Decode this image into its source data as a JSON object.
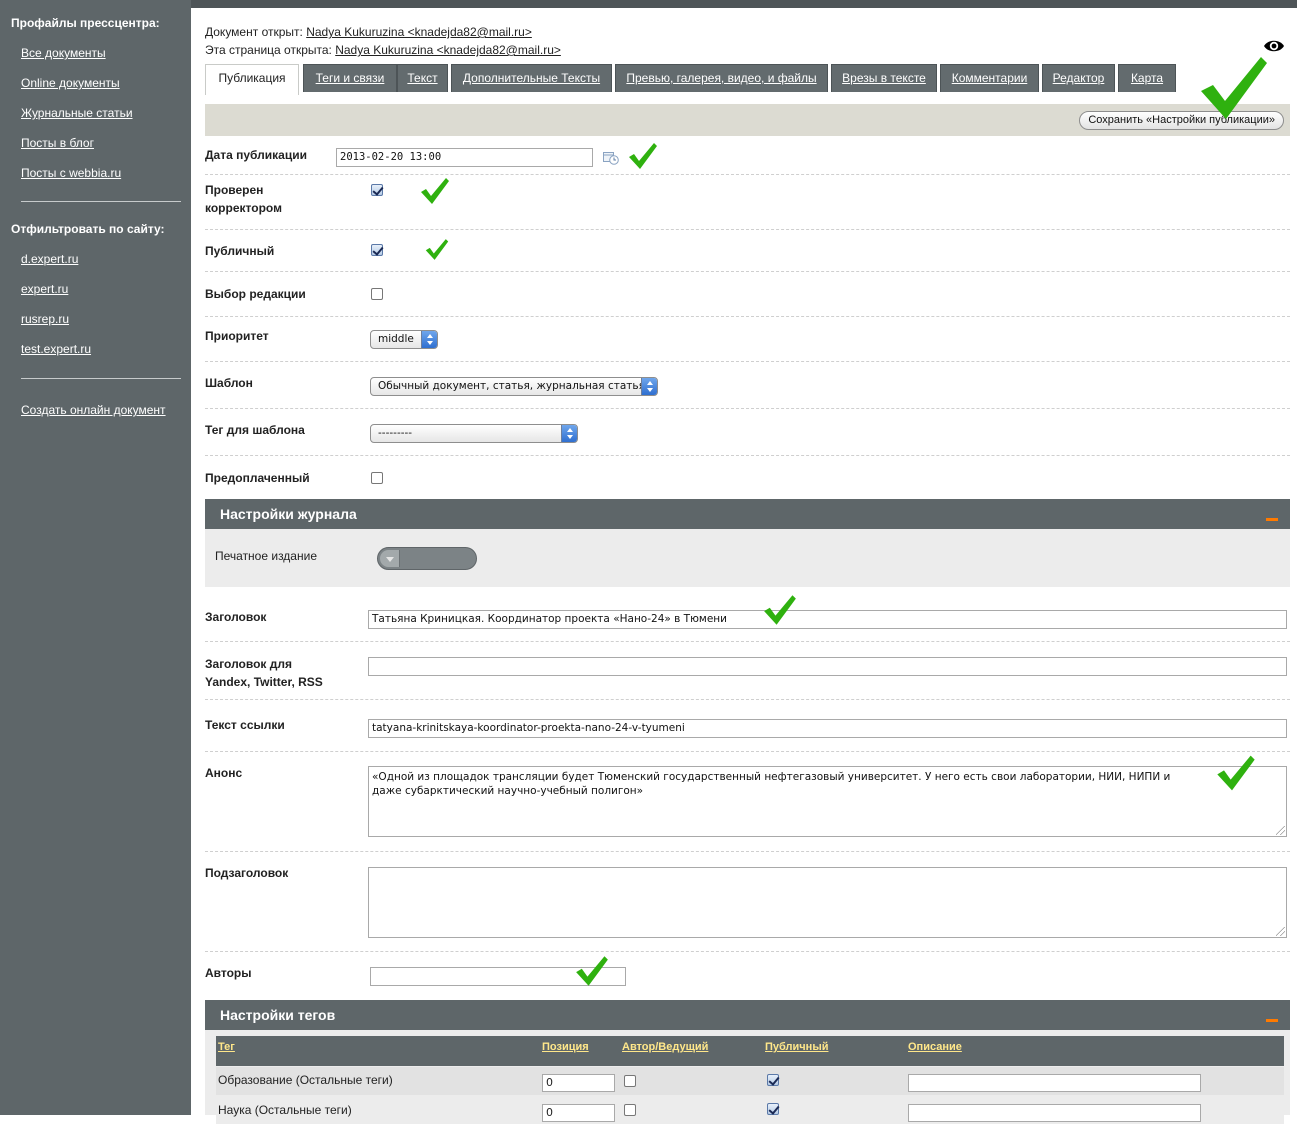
{
  "sidebar": {
    "profiles_heading": "Профайлы прессцентра:",
    "links": [
      "Все документы",
      "Online документы",
      "Журнальные статьи",
      "Посты в блог",
      "Посты с webbia.ru"
    ],
    "filter_heading": "Отфильтровать по сайту:",
    "sites": [
      "d.expert.ru",
      "expert.ru",
      "rusrep.ru",
      "test.expert.ru"
    ],
    "create_link": "Создать онлайн документ"
  },
  "header": {
    "doc_opened_label": "Документ открыт:",
    "doc_opened_user": "Nadya Kukuruzina <knadejda82@mail.ru>",
    "page_opened_label": "Эта страница открыта:",
    "page_opened_user": "Nadya Kukuruzina <knadejda82@mail.ru>",
    "preview_icon": "eye-icon"
  },
  "tabs": [
    "Публикация",
    "Теги и связи",
    "Текст",
    "Дополнительные Тексты",
    "Превью, галерея, видео, и файлы",
    "Врезы в тексте",
    "Комментарии",
    "Редактор",
    "Карта"
  ],
  "save_button": "Сохранить «Настройки публикации»",
  "publication": {
    "date_label": "Дата публикации",
    "date_value": "2013-02-20 13:00",
    "checked_by_label": "Проверен корректором",
    "checked_by": true,
    "public_label": "Публичный",
    "public": true,
    "editors_choice_label": "Выбор редакции",
    "editors_choice": false,
    "priority_label": "Приоритет",
    "priority_value": "middle",
    "template_label": "Шаблон",
    "template_value": "Обычный документ, статья, журнальная статья",
    "template_tag_label": "Тег для шаблона",
    "template_tag_value": "---------",
    "prepaid_label": "Предоплаченный",
    "prepaid": false
  },
  "journal": {
    "section_title": "Настройки журнала",
    "print_edition_label": "Печатное издание"
  },
  "content": {
    "title_label": "Заголовок",
    "title_value": "Татьяна Криницкая. Координатор проекта «Нано-24» в Тюмени",
    "alt_title_label": "Заголовок для Yandex, Twitter, RSS",
    "alt_title_value": "",
    "slug_label": "Текст ссылки",
    "slug_value": "tatyana-krinitskaya-koordinator-proekta-nano-24-v-tyumeni",
    "announce_label": "Анонс",
    "announce_value": "«Одной из  площадок трансляции будет Тюменский государственный нефтегазовый университет. У него есть свои лаборатории, НИИ, НИПИ и даже субарктический научно-учебный полигон»",
    "subtitle_label": "Подзаголовок",
    "subtitle_value": "",
    "authors_label": "Авторы",
    "authors_value": ""
  },
  "tags_section": {
    "title": "Настройки тегов",
    "columns": [
      "Тег",
      "Позиция",
      "Автор/Ведущий",
      "Публичный",
      "Описание"
    ],
    "rows": [
      {
        "name": "Образование (Остальные теги)",
        "position": "0",
        "author": false,
        "public": true,
        "description": ""
      },
      {
        "name": "Наука (Остальные теги)",
        "position": "0",
        "author": false,
        "public": true,
        "description": ""
      }
    ]
  },
  "colors": {
    "sidebar_bg": "#5e6669",
    "check_green": "#2fb10f",
    "collapse_orange": "#ff7a00",
    "tag_header_text": "#ffe78a"
  }
}
